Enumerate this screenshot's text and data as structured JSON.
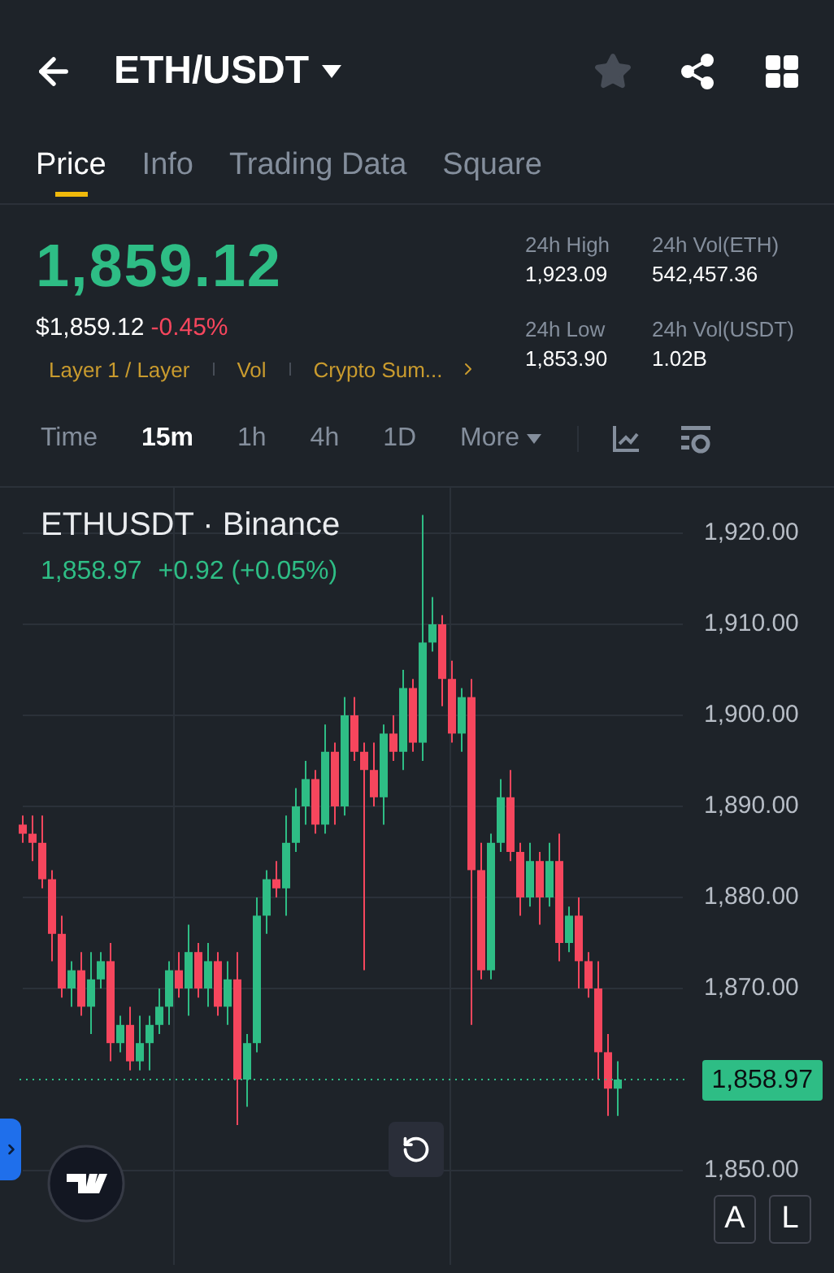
{
  "header": {
    "title": "ETH/USDT",
    "favorite": false
  },
  "tabs": [
    {
      "label": "Price",
      "selected": true
    },
    {
      "label": "Info",
      "selected": false
    },
    {
      "label": "Trading Data",
      "selected": false
    },
    {
      "label": "Square",
      "selected": false
    }
  ],
  "ticker": {
    "price": "1,859.12",
    "fiat_price": "$1,859.12",
    "change": "-0.45%",
    "negative": true,
    "tags": [
      "Layer 1 / Layer",
      "Vol",
      "Crypto Sum..."
    ],
    "stats": [
      {
        "label": "24h High",
        "value": "1,923.09"
      },
      {
        "label": "24h Vol(ETH)",
        "value": "542,457.36"
      },
      {
        "label": "24h Low",
        "value": "1,853.90"
      },
      {
        "label": "24h Vol(USDT)",
        "value": "1.02B"
      }
    ]
  },
  "intervals": [
    {
      "label": "Time",
      "selected": false
    },
    {
      "label": "15m",
      "selected": true
    },
    {
      "label": "1h",
      "selected": false
    },
    {
      "label": "4h",
      "selected": false
    },
    {
      "label": "1D",
      "selected": false
    }
  ],
  "more_label": "More",
  "chart": {
    "title": "ETHUSDT · Binance",
    "last": "1,858.97",
    "change": "+0.92 (+0.05%)",
    "current_price": "1,858.97",
    "scale_buttons": [
      "A",
      "L"
    ],
    "chart_data": {
      "type": "candlestick",
      "ylim": [
        1850,
        1920
      ],
      "yticks": [
        {
          "value": 1920,
          "label": "1,920.00"
        },
        {
          "value": 1910,
          "label": "1,910.00"
        },
        {
          "value": 1900,
          "label": "1,900.00"
        },
        {
          "value": 1890,
          "label": "1,890.00"
        },
        {
          "value": 1880,
          "label": "1,880.00"
        },
        {
          "value": 1870,
          "label": "1,870.00"
        },
        {
          "value": 1850,
          "label": "1,850.00"
        }
      ],
      "ohlc": [
        [
          1888,
          1889,
          1886,
          1887
        ],
        [
          1887,
          1889,
          1884,
          1886
        ],
        [
          1886,
          1889,
          1881,
          1882
        ],
        [
          1882,
          1883,
          1873,
          1876
        ],
        [
          1876,
          1878,
          1869,
          1870
        ],
        [
          1870,
          1873,
          1868,
          1872
        ],
        [
          1872,
          1874,
          1867,
          1868
        ],
        [
          1868,
          1874,
          1865,
          1871
        ],
        [
          1871,
          1874,
          1870,
          1873
        ],
        [
          1873,
          1875,
          1862,
          1864
        ],
        [
          1864,
          1867,
          1863,
          1866
        ],
        [
          1866,
          1868,
          1861,
          1862
        ],
        [
          1862,
          1867,
          1861,
          1864
        ],
        [
          1864,
          1867,
          1861,
          1866
        ],
        [
          1866,
          1870,
          1865,
          1868
        ],
        [
          1868,
          1873,
          1866,
          1872
        ],
        [
          1872,
          1874,
          1869,
          1870
        ],
        [
          1870,
          1877,
          1867,
          1874
        ],
        [
          1874,
          1875,
          1869,
          1870
        ],
        [
          1870,
          1875,
          1868,
          1873
        ],
        [
          1873,
          1874,
          1867,
          1868
        ],
        [
          1868,
          1873,
          1866,
          1871
        ],
        [
          1871,
          1874,
          1855,
          1860
        ],
        [
          1860,
          1865,
          1857,
          1864
        ],
        [
          1864,
          1880,
          1863,
          1878
        ],
        [
          1878,
          1883,
          1876,
          1882
        ],
        [
          1882,
          1884,
          1880,
          1881
        ],
        [
          1881,
          1889,
          1878,
          1886
        ],
        [
          1886,
          1892,
          1885,
          1890
        ],
        [
          1890,
          1895,
          1888,
          1893
        ],
        [
          1893,
          1894,
          1887,
          1888
        ],
        [
          1888,
          1899,
          1887,
          1896
        ],
        [
          1896,
          1897,
          1888,
          1890
        ],
        [
          1890,
          1902,
          1889,
          1900
        ],
        [
          1900,
          1902,
          1895,
          1896
        ],
        [
          1896,
          1897,
          1872,
          1894
        ],
        [
          1894,
          1897,
          1890,
          1891
        ],
        [
          1891,
          1899,
          1888,
          1898
        ],
        [
          1898,
          1900,
          1895,
          1896
        ],
        [
          1896,
          1905,
          1894,
          1903
        ],
        [
          1903,
          1904,
          1896,
          1897
        ],
        [
          1897,
          1922,
          1895,
          1908
        ],
        [
          1908,
          1913,
          1907,
          1910
        ],
        [
          1910,
          1911,
          1901,
          1904
        ],
        [
          1904,
          1906,
          1897,
          1898
        ],
        [
          1898,
          1903,
          1896,
          1902
        ],
        [
          1902,
          1904,
          1866,
          1883
        ],
        [
          1883,
          1886,
          1871,
          1872
        ],
        [
          1872,
          1887,
          1871,
          1886
        ],
        [
          1886,
          1893,
          1885,
          1891
        ],
        [
          1891,
          1894,
          1884,
          1885
        ],
        [
          1885,
          1886,
          1878,
          1880
        ],
        [
          1880,
          1886,
          1879,
          1884
        ],
        [
          1884,
          1885,
          1877,
          1880
        ],
        [
          1880,
          1886,
          1879,
          1884
        ],
        [
          1884,
          1887,
          1873,
          1875
        ],
        [
          1875,
          1879,
          1874,
          1878
        ],
        [
          1878,
          1880,
          1870,
          1873
        ],
        [
          1873,
          1874,
          1869,
          1870
        ],
        [
          1870,
          1873,
          1860,
          1863
        ],
        [
          1863,
          1865,
          1856,
          1859
        ],
        [
          1859,
          1862,
          1856,
          1860
        ]
      ]
    }
  }
}
